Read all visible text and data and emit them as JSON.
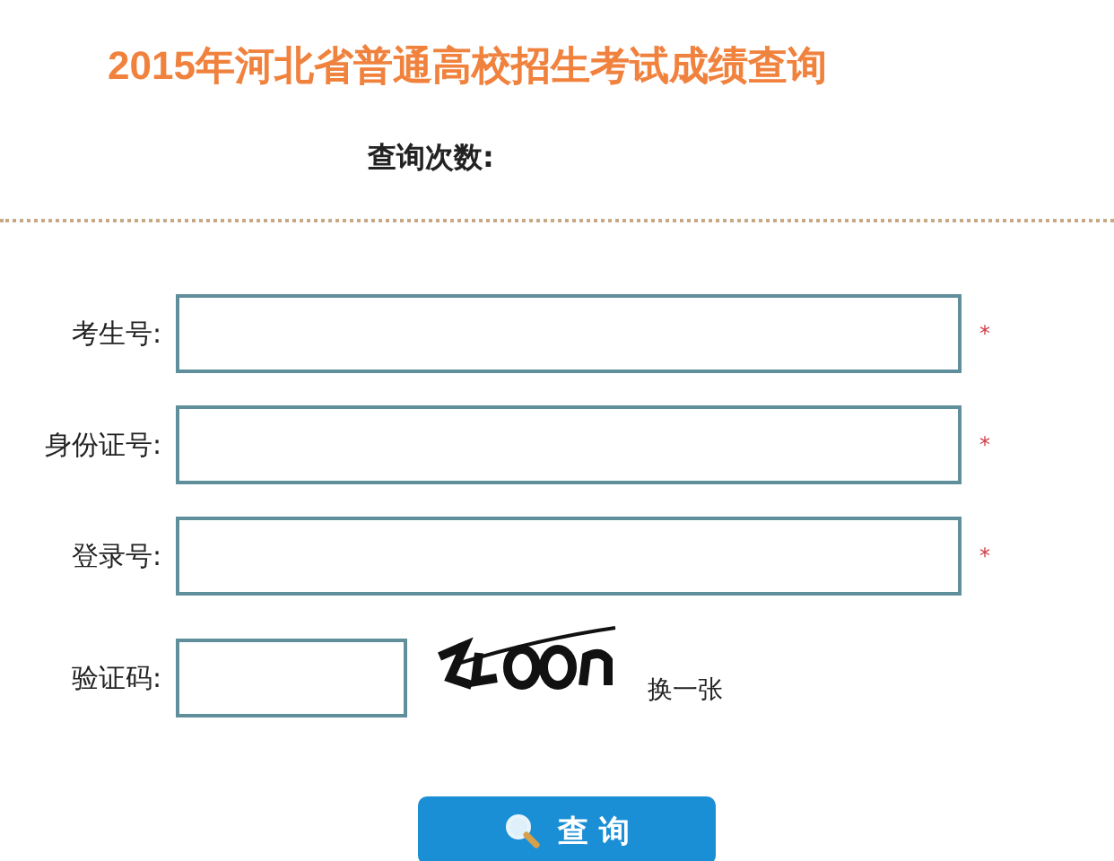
{
  "title": "2015年河北省普通高校招生考试成绩查询",
  "query_count": {
    "label": "查询次数:"
  },
  "fields": [
    {
      "label": "考生号:",
      "required_mark": "*"
    },
    {
      "label": "身份证号:",
      "required_mark": "*"
    },
    {
      "label": "登录号:",
      "required_mark": "*"
    }
  ],
  "captcha": {
    "label": "验证码:",
    "refresh_link": "换一张"
  },
  "submit_button": {
    "label": "查 询"
  }
}
